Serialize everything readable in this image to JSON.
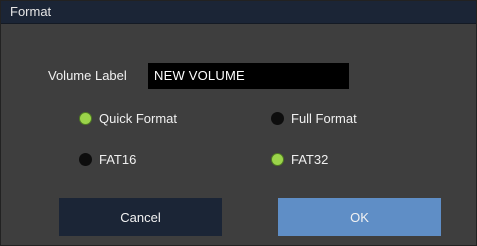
{
  "dialog": {
    "title": "Format"
  },
  "volume": {
    "label": "Volume Label",
    "value": "NEW VOLUME"
  },
  "format_mode": {
    "options": [
      {
        "label": "Quick Format",
        "selected": true
      },
      {
        "label": "Full Format",
        "selected": false
      }
    ]
  },
  "filesystem": {
    "options": [
      {
        "label": "FAT16",
        "selected": false
      },
      {
        "label": "FAT32",
        "selected": true
      }
    ]
  },
  "buttons": {
    "cancel": "Cancel",
    "ok": "OK"
  },
  "colors": {
    "dialog_bg": "#3e3e3e",
    "titlebar_bg": "#1b2536",
    "radio_on": "#9bd44a",
    "radio_off": "#0d0d0d",
    "cancel_bg": "#1b2536",
    "ok_bg": "#5f8ec6"
  }
}
